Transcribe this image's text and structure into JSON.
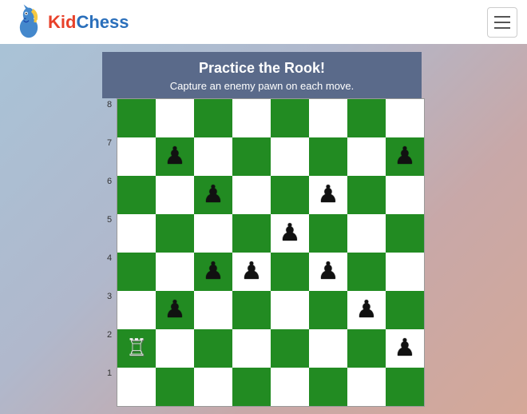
{
  "header": {
    "logo_kid": "Kid",
    "logo_chess": "Chess",
    "hamburger_label": "Menu"
  },
  "title_banner": {
    "heading": "Practice the Rook!",
    "subtext": "Capture an enemy pawn on each move."
  },
  "board": {
    "rank_labels": [
      "8",
      "7",
      "6",
      "5",
      "4",
      "3",
      "2",
      "1"
    ],
    "cells": [
      {
        "row": 1,
        "col": 1,
        "color": "white",
        "piece": null
      },
      {
        "row": 1,
        "col": 2,
        "color": "green",
        "piece": null
      },
      {
        "row": 1,
        "col": 3,
        "color": "white",
        "piece": null
      },
      {
        "row": 1,
        "col": 4,
        "color": "green",
        "piece": null
      },
      {
        "row": 1,
        "col": 5,
        "color": "white",
        "piece": null
      },
      {
        "row": 1,
        "col": 6,
        "color": "green",
        "piece": null
      },
      {
        "row": 1,
        "col": 7,
        "color": "white",
        "piece": null
      },
      {
        "row": 1,
        "col": 8,
        "color": "green",
        "piece": null
      },
      {
        "row": 2,
        "col": 1,
        "color": "green",
        "piece": "white-rook"
      },
      {
        "row": 2,
        "col": 2,
        "color": "white",
        "piece": null
      },
      {
        "row": 2,
        "col": 3,
        "color": "green",
        "piece": null
      },
      {
        "row": 2,
        "col": 4,
        "color": "white",
        "piece": null
      },
      {
        "row": 2,
        "col": 5,
        "color": "green",
        "piece": null
      },
      {
        "row": 2,
        "col": 6,
        "color": "white",
        "piece": null
      },
      {
        "row": 2,
        "col": 7,
        "color": "green",
        "piece": null
      },
      {
        "row": 2,
        "col": 8,
        "color": "white",
        "piece": "black-pawn"
      },
      {
        "row": 3,
        "col": 1,
        "color": "white",
        "piece": null
      },
      {
        "row": 3,
        "col": 2,
        "color": "green",
        "piece": "black-pawn"
      },
      {
        "row": 3,
        "col": 3,
        "color": "white",
        "piece": null
      },
      {
        "row": 3,
        "col": 4,
        "color": "green",
        "piece": null
      },
      {
        "row": 3,
        "col": 5,
        "color": "white",
        "piece": null
      },
      {
        "row": 3,
        "col": 6,
        "color": "green",
        "piece": null
      },
      {
        "row": 3,
        "col": 7,
        "color": "white",
        "piece": "black-pawn"
      },
      {
        "row": 3,
        "col": 8,
        "color": "green",
        "piece": null
      },
      {
        "row": 4,
        "col": 1,
        "color": "green",
        "piece": null
      },
      {
        "row": 4,
        "col": 2,
        "color": "white",
        "piece": null
      },
      {
        "row": 4,
        "col": 3,
        "color": "green",
        "piece": "black-pawn"
      },
      {
        "row": 4,
        "col": 4,
        "color": "white",
        "piece": "black-pawn"
      },
      {
        "row": 4,
        "col": 5,
        "color": "green",
        "piece": null
      },
      {
        "row": 4,
        "col": 6,
        "color": "white",
        "piece": "black-pawn"
      },
      {
        "row": 4,
        "col": 7,
        "color": "green",
        "piece": null
      },
      {
        "row": 4,
        "col": 8,
        "color": "white",
        "piece": null
      },
      {
        "row": 5,
        "col": 1,
        "color": "white",
        "piece": null
      },
      {
        "row": 5,
        "col": 2,
        "color": "green",
        "piece": null
      },
      {
        "row": 5,
        "col": 3,
        "color": "white",
        "piece": null
      },
      {
        "row": 5,
        "col": 4,
        "color": "green",
        "piece": null
      },
      {
        "row": 5,
        "col": 5,
        "color": "white",
        "piece": "black-pawn"
      },
      {
        "row": 5,
        "col": 6,
        "color": "green",
        "piece": null
      },
      {
        "row": 5,
        "col": 7,
        "color": "white",
        "piece": null
      },
      {
        "row": 5,
        "col": 8,
        "color": "green",
        "piece": null
      },
      {
        "row": 6,
        "col": 1,
        "color": "green",
        "piece": null
      },
      {
        "row": 6,
        "col": 2,
        "color": "white",
        "piece": null
      },
      {
        "row": 6,
        "col": 3,
        "color": "green",
        "piece": "black-pawn"
      },
      {
        "row": 6,
        "col": 4,
        "color": "white",
        "piece": null
      },
      {
        "row": 6,
        "col": 5,
        "color": "green",
        "piece": null
      },
      {
        "row": 6,
        "col": 6,
        "color": "white",
        "piece": "black-pawn"
      },
      {
        "row": 6,
        "col": 7,
        "color": "green",
        "piece": null
      },
      {
        "row": 6,
        "col": 8,
        "color": "white",
        "piece": null
      },
      {
        "row": 7,
        "col": 1,
        "color": "white",
        "piece": null
      },
      {
        "row": 7,
        "col": 2,
        "color": "green",
        "piece": "black-pawn"
      },
      {
        "row": 7,
        "col": 3,
        "color": "white",
        "piece": null
      },
      {
        "row": 7,
        "col": 4,
        "color": "green",
        "piece": null
      },
      {
        "row": 7,
        "col": 5,
        "color": "white",
        "piece": null
      },
      {
        "row": 7,
        "col": 6,
        "color": "green",
        "piece": null
      },
      {
        "row": 7,
        "col": 7,
        "color": "white",
        "piece": null
      },
      {
        "row": 7,
        "col": 8,
        "color": "green",
        "piece": "black-pawn"
      },
      {
        "row": 8,
        "col": 1,
        "color": "green",
        "piece": null
      },
      {
        "row": 8,
        "col": 2,
        "color": "white",
        "piece": null
      },
      {
        "row": 8,
        "col": 3,
        "color": "green",
        "piece": null
      },
      {
        "row": 8,
        "col": 4,
        "color": "white",
        "piece": null
      },
      {
        "row": 8,
        "col": 5,
        "color": "green",
        "piece": null
      },
      {
        "row": 8,
        "col": 6,
        "color": "white",
        "piece": null
      },
      {
        "row": 8,
        "col": 7,
        "color": "green",
        "piece": null
      },
      {
        "row": 8,
        "col": 8,
        "color": "white",
        "piece": null
      }
    ]
  }
}
